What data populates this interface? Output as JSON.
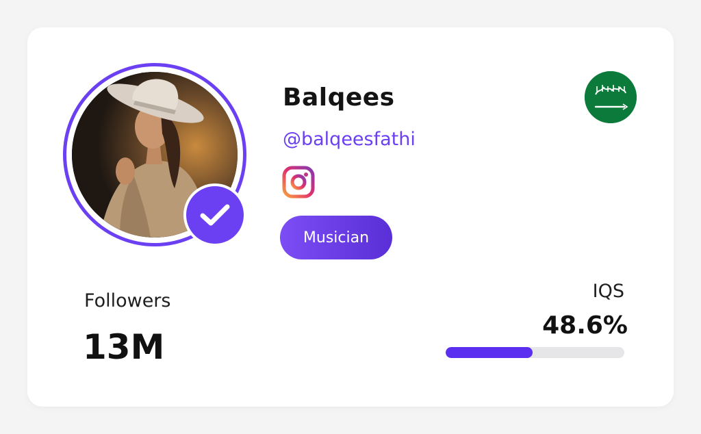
{
  "profile": {
    "name": "Balqees",
    "handle": "@balqeesfathi",
    "category": "Musician",
    "platform_icon": "instagram-icon",
    "verified": true,
    "country_flag": "saudi-arabia-flag"
  },
  "stats": {
    "followers_label": "Followers",
    "followers_value": "13M",
    "iqs_label": "IQS",
    "iqs_value": "48.6%",
    "iqs_progress": 0.486
  },
  "colors": {
    "accent": "#6b3ff2",
    "flag_green": "#0b7a3b",
    "track": "#e6e6e8"
  }
}
